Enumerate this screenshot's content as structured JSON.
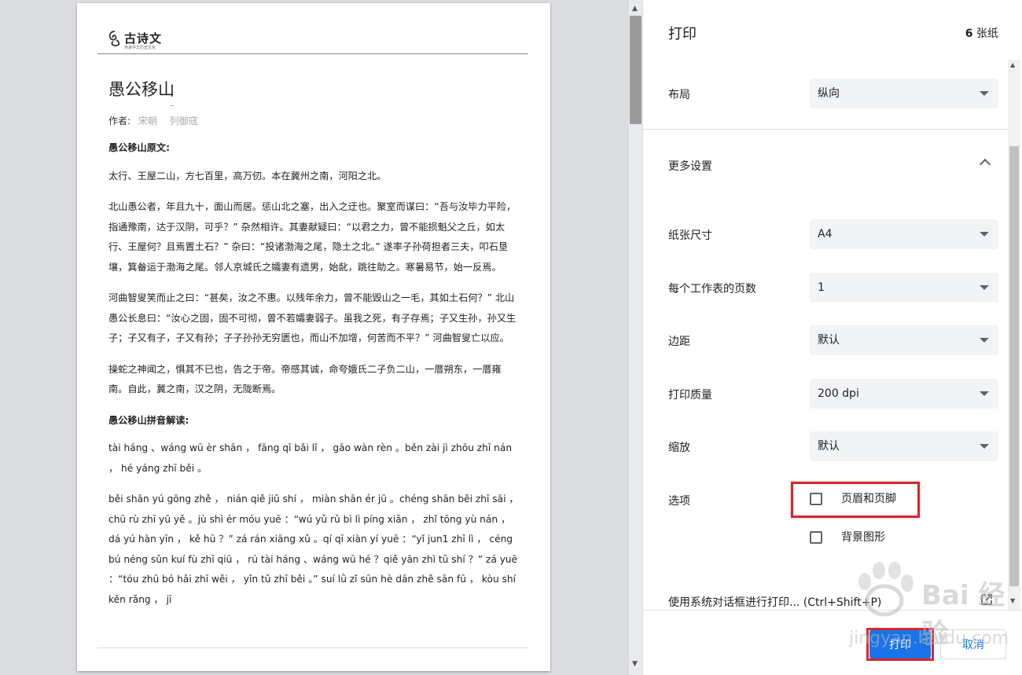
{
  "preview": {
    "logo_brand": "古诗文",
    "logo_tagline": "传承中华历史文化",
    "title": "愚公移山",
    "author_label": "作者:",
    "dynasty": "宋朝",
    "author": "列御寇",
    "paragraphs": [
      {
        "text": "愚公移山原文:",
        "heading": true
      },
      {
        "text": "太行、王屋二山，方七百里，高万仞。本在冀州之南，河阳之北。",
        "heading": false
      },
      {
        "text": "北山愚公者，年且九十，面山而居。惩山北之塞，出入之迂也。聚室而谋曰：“吾与汝毕力平险，指通豫南，达于汉阴，可乎？” 杂然相许。其妻献疑曰：“以君之力，曾不能损魁父之丘，如太行、王屋何？且焉置土石？” 杂曰：“投诸渤海之尾，隐土之北。” 遂率子孙荷担者三夫，叩石垦壤，箕畚运于渤海之尾。邻人京城氏之孀妻有遗男，始龀，跳往助之。寒暑易节，始一反焉。",
        "heading": false
      },
      {
        "text": "河曲智叟笑而止之曰：“甚矣，汝之不惠。以残年余力，曾不能毁山之一毛，其如土石何？” 北山愚公长息曰：“汝心之固，固不可彻，曾不若孀妻弱子。虽我之死，有子存焉；子又生孙，孙又生子；子又有子，子又有孙；子子孙孙无穷匮也，而山不加增，何苦而不平？” 河曲智叟亡以应。",
        "heading": false
      },
      {
        "text": "操蛇之神闻之，惧其不已也，告之于帝。帝感其诚，命夸娥氏二子负二山，一厝朔东，一厝雍南。自此，冀之南，汉之阴，无陇断焉。",
        "heading": false
      },
      {
        "text": "愚公移山拼音解读:",
        "heading": true
      },
      {
        "text": "tài háng 、wáng wū èr shān ， fāng qī bǎi lǐ ， gāo wàn rèn 。běn zài jì zhōu zhī nán ， hé yáng zhī běi 。",
        "heading": false
      },
      {
        "text": "běi shān yú gōng zhě ， nián qiě jiǔ shí ， miàn shān ér jū 。chéng shān běi zhī sāi ， chū rù zhī yū yě 。jù shì ér móu yuē ：“wú yǔ rǔ bì lì píng xiǎn ， zhǐ tōng yù nán ， dá yú hàn yīn ， kě hū ？” zá rán xiāng xǔ 。qí qī xiàn yí yuē ：“yǐ jun1 zhī lì ， céng bú néng sǔn kuí fù zhī qiū ， rú tài háng 、wáng wū hé ？qiě yān zhì tǔ shí ？” zá yuē ：“tóu zhū bó hǎi zhī wěi ， yǐn tǔ zhī běi 。” suí lǜ zǐ sūn hè dān zhě sān fū ， kòu shí kěn rǎng ， jī",
        "heading": false
      }
    ]
  },
  "panel": {
    "title": "打印",
    "sheet_count": "6",
    "sheet_unit": "张纸",
    "layout": {
      "label": "布局",
      "value": "纵向"
    },
    "more_settings": "更多设置",
    "paper_size": {
      "label": "纸张尺寸",
      "value": "A4"
    },
    "pages_per_sheet": {
      "label": "每个工作表的页数",
      "value": "1"
    },
    "margins": {
      "label": "边距",
      "value": "默认"
    },
    "quality": {
      "label": "打印质量",
      "value": "200 dpi"
    },
    "scale": {
      "label": "缩放",
      "value": "默认"
    },
    "options": {
      "label": "选项",
      "headers_footers": {
        "label": "页眉和页脚",
        "checked": false
      },
      "background_graphics": {
        "label": "背景图形",
        "checked": false
      }
    },
    "system_dialog": "使用系统对话框进行打印... (Ctrl+Shift+P)",
    "print_button": "打印",
    "cancel_button": "取消"
  },
  "watermark": {
    "text": "Bai 经验",
    "url": "jingyan.baidu.com"
  },
  "colors": {
    "accent": "#1a73e8",
    "highlight": "#d9262b"
  }
}
